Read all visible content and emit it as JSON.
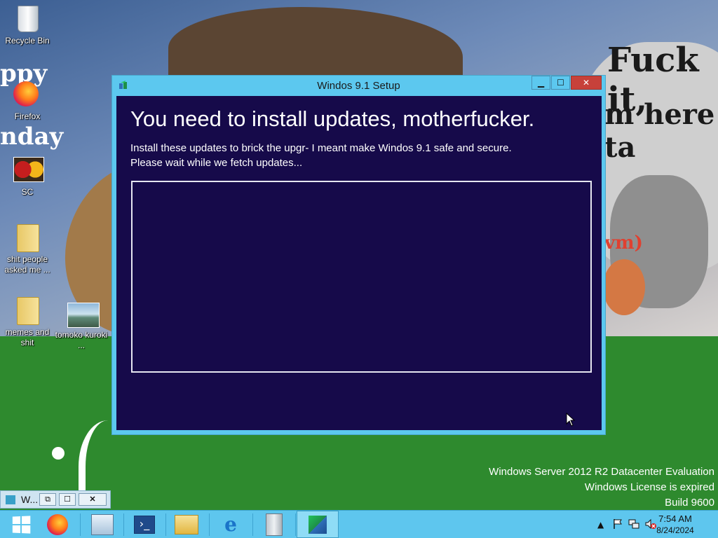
{
  "desktop": {
    "icons": [
      {
        "label": "Recycle Bin",
        "icon": "recycle-bin-icon"
      },
      {
        "label": "Firefox",
        "icon": "firefox-icon"
      },
      {
        "label": "SC",
        "icon": "flower-image-icon"
      },
      {
        "label": "shit people asked me ...",
        "icon": "folder-icon"
      },
      {
        "label": "memes and shit",
        "icon": "folder-icon"
      },
      {
        "label": "tomoko kuroki ...",
        "icon": "image-file-icon"
      }
    ],
    "wallpaper_text": [
      "Fuck it,",
      "m here ta",
      "ppy",
      "nday",
      "vm)"
    ]
  },
  "setup_window": {
    "title": "Windos 9.1 Setup",
    "heading": "You need to install updates, motherfucker.",
    "description_line1": "Install these updates to brick the upgr- I meant make Windos 9.1 safe and secure.",
    "description_line2": "Please wait while we fetch updates...",
    "buttons": {
      "minimize": "▁",
      "maximize": "☐",
      "close": "✕"
    }
  },
  "minimized_window": {
    "label": "W...",
    "buttons": {
      "restore": "⧉",
      "maximize": "☐",
      "close": "✕"
    }
  },
  "watermark": {
    "line1": "Windows Server 2012 R2 Datacenter Evaluation",
    "line2": "Windows License is expired",
    "line3": "Build 9600"
  },
  "taskbar": {
    "items": [
      {
        "name": "start",
        "icon": "windows-logo-icon"
      },
      {
        "name": "firefox",
        "icon": "firefox-icon"
      },
      {
        "name": "server-manager",
        "icon": "server-manager-icon"
      },
      {
        "name": "powershell",
        "icon": "powershell-icon",
        "glyph": "›_"
      },
      {
        "name": "file-explorer",
        "icon": "folder-icon"
      },
      {
        "name": "internet-explorer",
        "icon": "internet-explorer-icon",
        "glyph": "e"
      },
      {
        "name": "tool",
        "icon": "tool-icon"
      },
      {
        "name": "windos-setup",
        "icon": "setup-icon",
        "active": true
      }
    ],
    "tray": {
      "time": "7:54 AM",
      "date": "8/24/2024",
      "icons": [
        "chevron-up-icon",
        "flag-icon",
        "network-icon",
        "volume-muted-icon"
      ]
    }
  },
  "colors": {
    "window_frame": "#5cc8ef",
    "window_content": "#160a4a",
    "close_button": "#c7413a",
    "taskbar": "#5ec6ee",
    "grass": "#2e8a2e"
  }
}
